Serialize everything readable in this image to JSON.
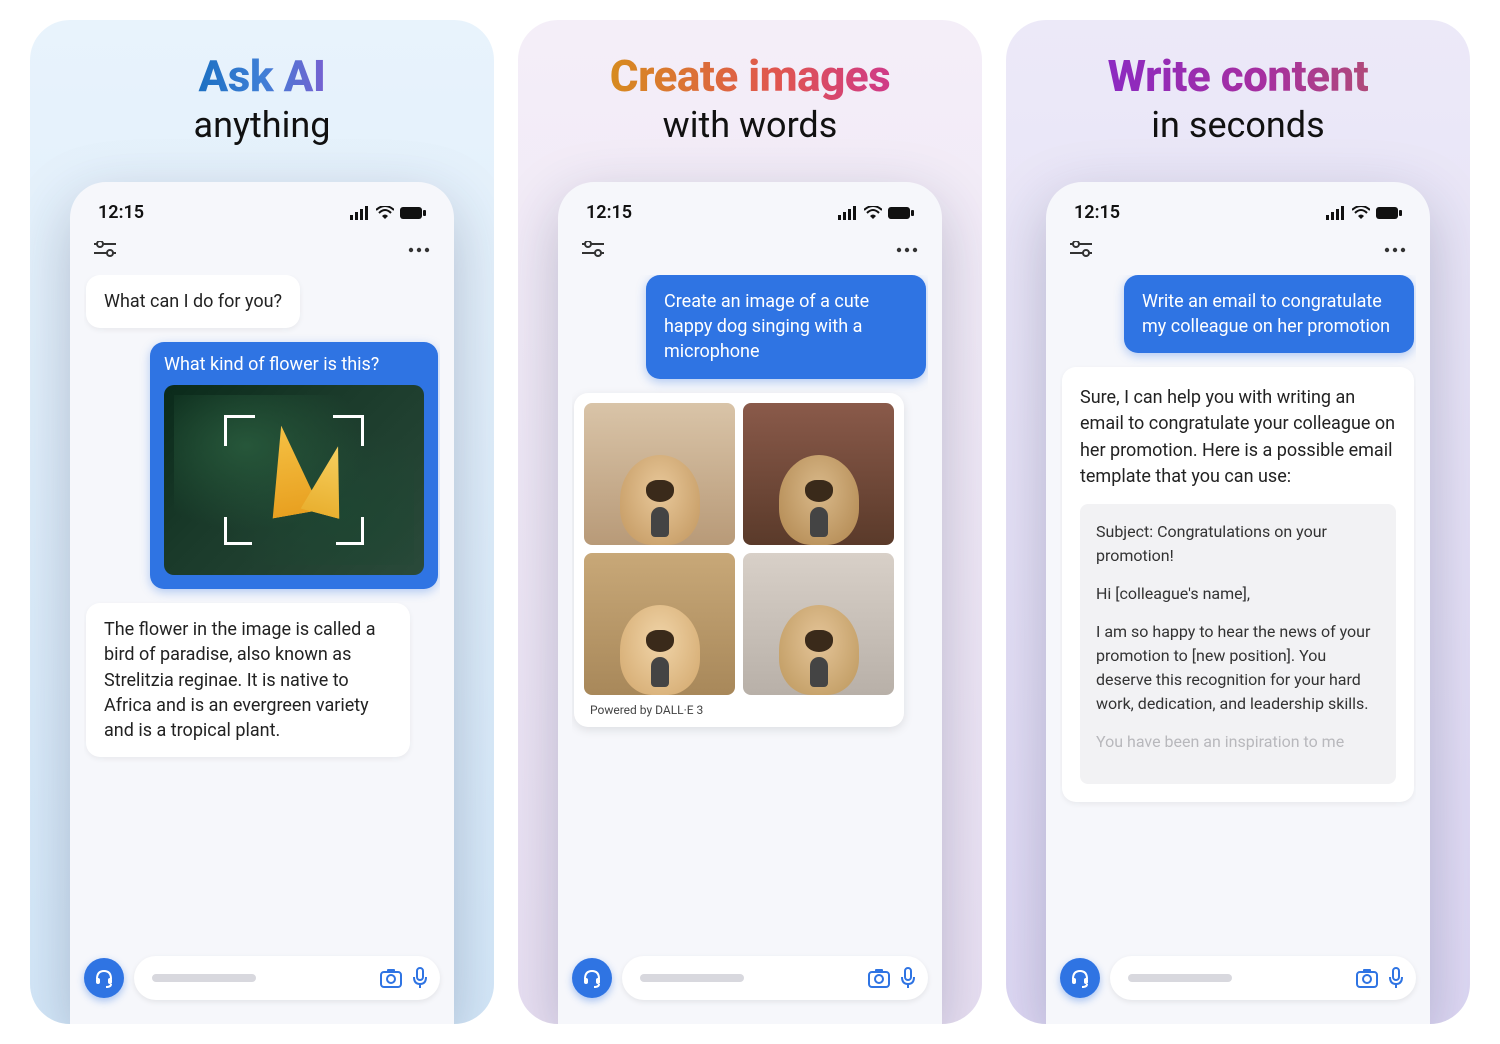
{
  "panels": [
    {
      "headline_top": "Ask AI",
      "headline_bottom": "anything",
      "status_time": "12:15",
      "ai_greeting": "What can I do for you?",
      "user_question": "What kind of flower is this?",
      "ai_answer": "The flower in the image is called a bird of paradise, also known as Strelitzia reginae. It is native to Africa and is an evergreen variety and is a tropical plant."
    },
    {
      "headline_top": "Create images",
      "headline_bottom": "with words",
      "status_time": "12:15",
      "user_prompt": "Create an image of a cute happy dog singing with a microphone",
      "powered_by": "Powered by DALL·E 3"
    },
    {
      "headline_top": "Write content",
      "headline_bottom": "in seconds",
      "status_time": "12:15",
      "user_request": "Write an email to congratulate my colleague on her promotion",
      "ai_intro": "Sure, I can help you with writing an email to congratulate your colleague on her promotion. Here is a possible email template that you can use:",
      "email_subject": "Subject: Congratulations on your promotion!",
      "email_greeting": "Hi [colleague's name],",
      "email_body_1": "I am so happy to hear the news of your promotion to [new position]. You deserve this recognition for your hard work, dedication, and leadership skills.",
      "email_body_2_fade": "You have been an inspiration to me"
    }
  ]
}
